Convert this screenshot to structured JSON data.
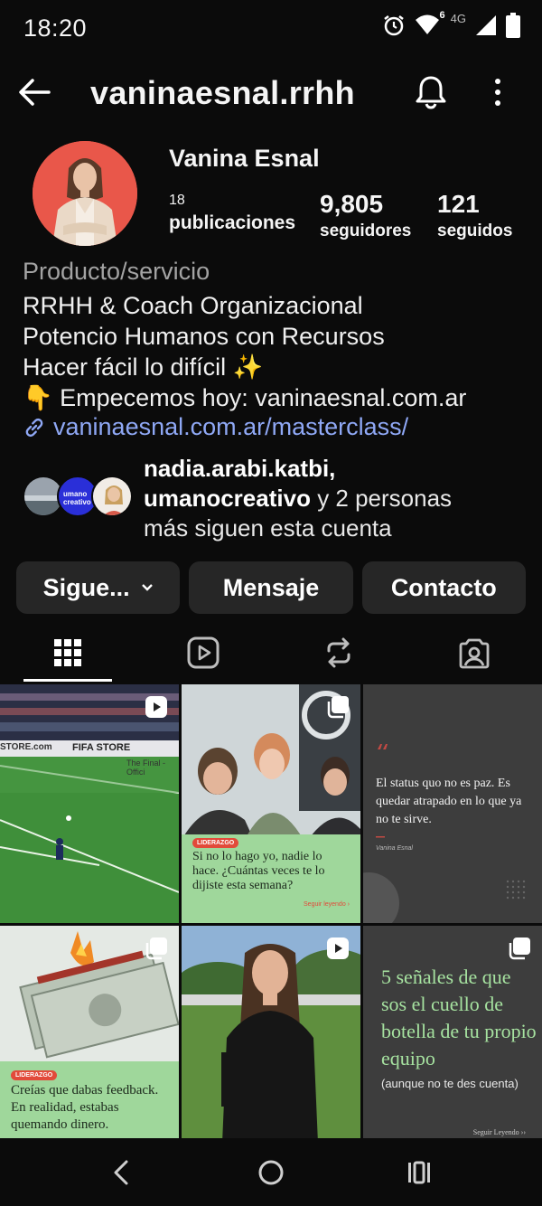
{
  "status_bar": {
    "time": "18:20",
    "network": "4G",
    "wifi_badge": "6",
    "icons": [
      "alarm-icon",
      "wifi-icon",
      "signal-icon",
      "battery-icon"
    ]
  },
  "header": {
    "username": "vaninaesnal.rrhh",
    "icons": [
      "back-arrow-icon",
      "bell-icon",
      "more-vertical-icon"
    ]
  },
  "profile": {
    "name": "Vanina Esnal",
    "stats": {
      "posts_count": "18",
      "posts_label": "publicaciones",
      "followers_count": "9,805",
      "followers_label": "seguidores",
      "following_count": "121",
      "following_label": "seguidos"
    },
    "category": "Producto/servicio",
    "bio_lines": [
      "RRHH & Coach Organizacional",
      "Potencio Humanos con Recursos",
      "Hacer fácil lo difícil ✨",
      "👇 Empecemos hoy: vaninaesnal.com.ar"
    ],
    "link": "vaninaesnal.com.ar/masterclass/",
    "followed_by": {
      "user1": "nadia.arabi.katbi,",
      "user2": "umanocreativo",
      "rest_a": "y 2 personas",
      "rest_b": "más siguen esta cuenta",
      "avatar_label": "umano creativo"
    }
  },
  "actions": {
    "follow": "Sigue...",
    "message": "Mensaje",
    "contact": "Contacto"
  },
  "tabs": [
    "grid-icon",
    "reels-icon",
    "reposts-icon",
    "tagged-icon"
  ],
  "grid": [
    {
      "kind": "football-video",
      "store_text": "FIFA STORE",
      "store_left": "STORE.com",
      "store_right": "The Final - Offici"
    },
    {
      "kind": "meeting-post",
      "tag": "LIDERAZGO",
      "caption": "Si no lo hago yo, nadie lo hace. ¿Cuántas veces te lo dijiste esta semana?",
      "cta": "Seguir leyendo ›"
    },
    {
      "kind": "quote-post",
      "quote": "El status quo no es paz. Es quedar atrapado en lo que ya no te sirve.",
      "author": "Vanina Esnal"
    },
    {
      "kind": "money-post",
      "tag": "LIDERAZGO",
      "caption": "Creías que dabas feedback. En realidad, estabas quemando dinero."
    },
    {
      "kind": "person-video"
    },
    {
      "kind": "list-post",
      "title": "5 señales de que sos el cuello de botella de tu propio equipo",
      "subtitle": "(aunque no te des cuenta)",
      "cta": "Seguir Leyendo ››"
    }
  ],
  "colors": {
    "background": "#0b0b0b",
    "button": "#262626",
    "link": "#8fa8f5",
    "avatar_bg": "#e9574a",
    "green_post": "#9fd79b",
    "dark_post": "#3d3d3d"
  },
  "nav_bar": [
    "back-nav-icon",
    "home-nav-icon",
    "recents-nav-icon"
  ]
}
